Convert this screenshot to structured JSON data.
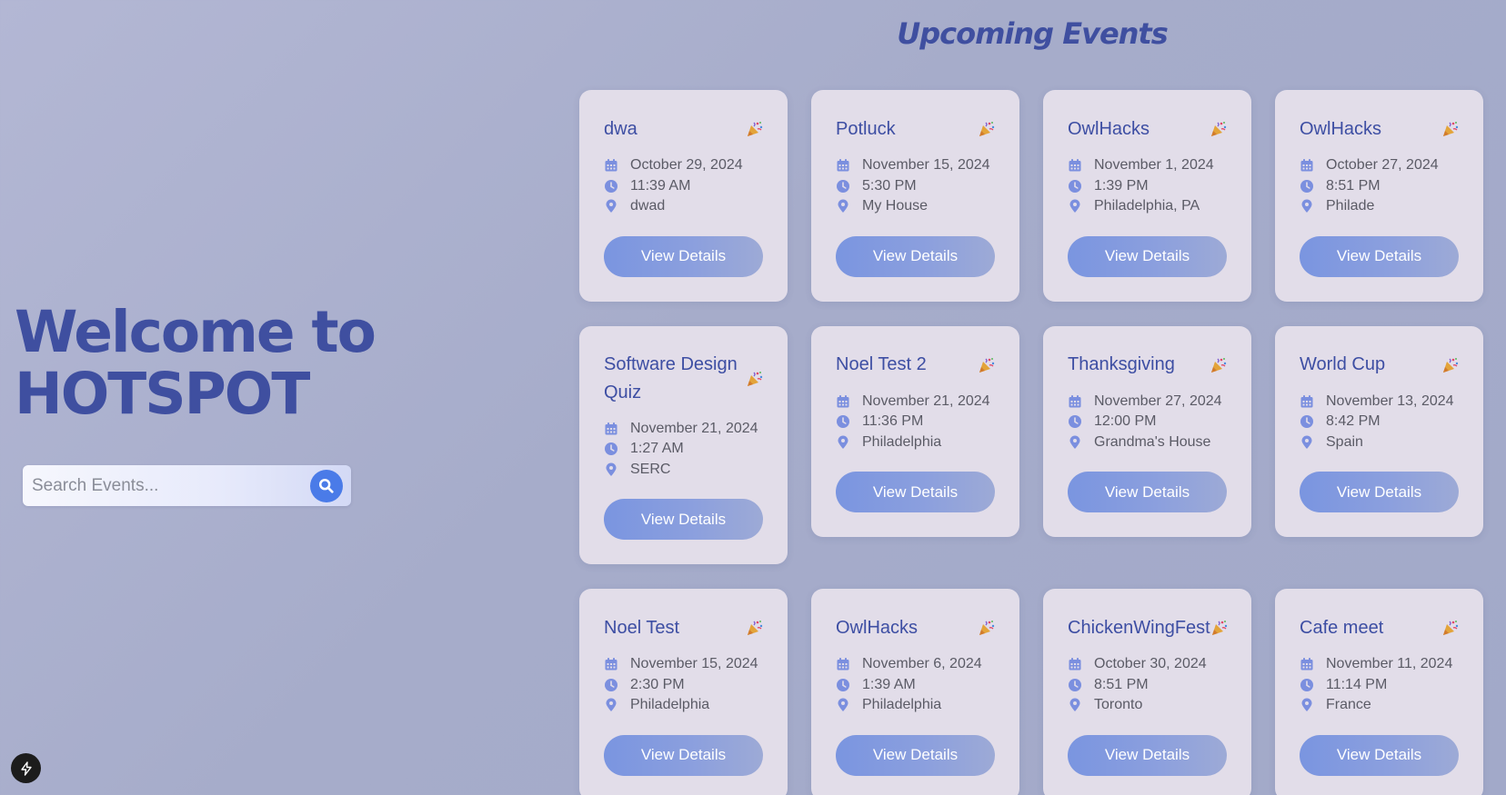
{
  "hero": {
    "title_line1": "Welcome to",
    "title_line2": "HOTSPOT"
  },
  "search": {
    "placeholder": "Search Events...",
    "icon": "search-icon"
  },
  "events_section": {
    "title": "Upcoming Events",
    "button_label": "View Details",
    "card_icon": "party-popper-icon"
  },
  "events": [
    {
      "name": "dwa",
      "date": "October 29, 2024",
      "time": "11:39 AM",
      "location": "dwad"
    },
    {
      "name": "Potluck",
      "date": "November 15, 2024",
      "time": "5:30 PM",
      "location": "My House"
    },
    {
      "name": "OwlHacks",
      "date": "November 1, 2024",
      "time": "1:39 PM",
      "location": "Philadelphia, PA"
    },
    {
      "name": "OwlHacks",
      "date": "October 27, 2024",
      "time": "8:51 PM",
      "location": "Philade"
    },
    {
      "name": "Software Design Quiz",
      "date": "November 21, 2024",
      "time": "1:27 AM",
      "location": "SERC"
    },
    {
      "name": "Noel Test 2",
      "date": "November 21, 2024",
      "time": "11:36 PM",
      "location": "Philadelphia"
    },
    {
      "name": "Thanksgiving",
      "date": "November 27, 2024",
      "time": "12:00 PM",
      "location": "Grandma's House"
    },
    {
      "name": "World Cup",
      "date": "November 13, 2024",
      "time": "8:42 PM",
      "location": "Spain"
    },
    {
      "name": "Noel Test",
      "date": "November 15, 2024",
      "time": "2:30 PM",
      "location": "Philadelphia"
    },
    {
      "name": "OwlHacks",
      "date": "November 6, 2024",
      "time": "1:39 AM",
      "location": "Philadelphia"
    },
    {
      "name": "ChickenWingFest",
      "date": "October 30, 2024",
      "time": "8:51 PM",
      "location": "Toronto"
    },
    {
      "name": "Cafe meet",
      "date": "November 11, 2024",
      "time": "11:14 PM",
      "location": "France"
    }
  ],
  "colors": {
    "accent": "#3f4fa0",
    "search_button": "#4a7be8",
    "card_background": "#e2dde9",
    "meta_icon": "#7b8fdf"
  },
  "corner_button": {
    "icon": "lightning-icon"
  }
}
